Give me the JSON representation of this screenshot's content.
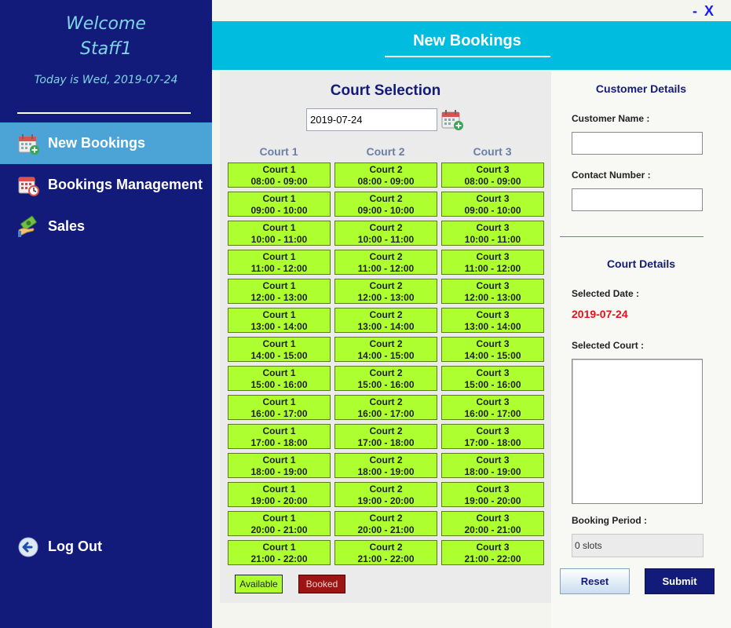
{
  "sidebar": {
    "welcome_line1": "Welcome",
    "welcome_line2": "Staff1",
    "today_text": "Today is Wed, 2019-07-24",
    "nav": [
      {
        "label": "New Bookings",
        "icon": "calendar-add-icon",
        "active": true
      },
      {
        "label": "Bookings Management",
        "icon": "calendar-clock-icon",
        "active": false
      },
      {
        "label": "Sales",
        "icon": "money-hand-icon",
        "active": false
      }
    ],
    "logout_label": "Log Out"
  },
  "window_controls": {
    "minimize": "-",
    "close": "X"
  },
  "header": {
    "title": "New Bookings"
  },
  "court_selection": {
    "title": "Court Selection",
    "date_value": "2019-07-24",
    "columns": [
      "Court 1",
      "Court 2",
      "Court 3"
    ],
    "time_slots": [
      "08:00 - 09:00",
      "09:00 - 10:00",
      "10:00 - 11:00",
      "11:00 - 12:00",
      "12:00 - 13:00",
      "13:00 - 14:00",
      "14:00 - 15:00",
      "15:00 - 16:00",
      "16:00 - 17:00",
      "17:00 - 18:00",
      "18:00 - 19:00",
      "19:00 - 20:00",
      "20:00 - 21:00",
      "21:00 - 22:00"
    ],
    "legend": {
      "available": "Available",
      "booked": "Booked"
    },
    "colors": {
      "available": "#adff2f",
      "booked": "#9b1515"
    }
  },
  "customer_details": {
    "title": "Customer Details",
    "name_label": "Customer Name :",
    "name_value": "",
    "contact_label": "Contact Number :",
    "contact_value": ""
  },
  "court_details": {
    "title": "Court Details",
    "selected_date_label": "Selected Date :",
    "selected_date_value": "2019-07-24",
    "selected_court_label": "Selected Court :",
    "booking_period_label": "Booking Period :",
    "booking_period_value": "0 slots"
  },
  "buttons": {
    "reset": "Reset",
    "submit": "Submit"
  },
  "theme": {
    "sidebar": "#131b7a",
    "header": "#00bde0",
    "active_nav": "#4ba3d6",
    "accent_red": "#e0141a"
  }
}
